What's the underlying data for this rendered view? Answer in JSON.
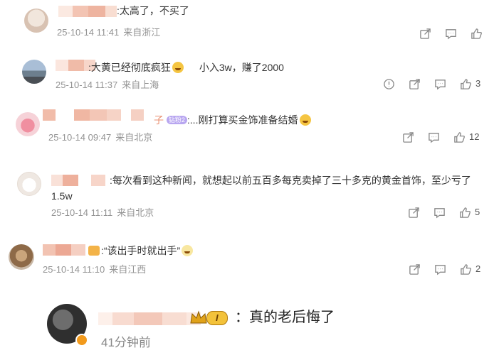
{
  "comments": [
    {
      "text": ":太高了，不买了",
      "time": "25-10-14 11:41",
      "location": "来自浙江",
      "icons": [
        "share-icon",
        "comment-icon",
        "like-icon"
      ],
      "likes": ""
    },
    {
      "text": ":大黄已经彻底疯狂",
      "text2": "小入3w，赚了2000",
      "time": "25-10-14 11:37",
      "location": "来自上海",
      "icons": [
        "report-icon",
        "share-icon",
        "comment-icon",
        "like-icon"
      ],
      "likes": "3"
    },
    {
      "name_suffix": "子",
      "badge": "钻粉2",
      "text": ":...刚打算买金饰准备结婚",
      "time": "25-10-14 09:47",
      "location": "来自北京",
      "icons": [
        "share-icon",
        "comment-icon",
        "like-icon"
      ],
      "likes": "12"
    },
    {
      "text": ":每次看到这种新闻，就想起以前五百多每克卖掉了三十多克的黄金首饰，至少亏了",
      "text_line2": "1.5w",
      "time": "25-10-14 11:11",
      "location": "来自北京",
      "icons": [
        "share-icon",
        "comment-icon",
        "like-icon"
      ],
      "likes": "5"
    },
    {
      "text": ":“该出手时就出手”",
      "time": "25-10-14 11:10",
      "location": "来自江西",
      "icons": [
        "share-icon",
        "comment-icon",
        "like-icon"
      ],
      "likes": "2"
    }
  ],
  "reply": {
    "level": "I",
    "text": "：真的老后悔了",
    "time": "41分钟前"
  },
  "colors": {
    "meta": "#939393",
    "mosaic_light": "#f6d5c8",
    "mosaic_dark": "#e9a896",
    "badge": "#b8a6f0",
    "crown": "#e0a21a"
  }
}
